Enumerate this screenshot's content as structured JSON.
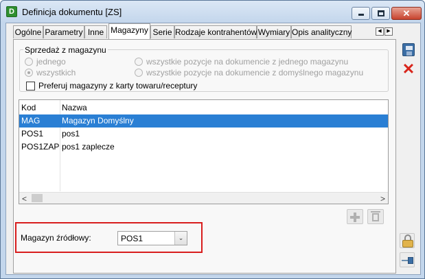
{
  "window": {
    "title": "Definicja dokumentu [ZS]",
    "app_icon_letter": "D",
    "min_glyph": "",
    "close_glyph": "✕"
  },
  "tabs": [
    {
      "label": "Ogólne"
    },
    {
      "label": "Parametry"
    },
    {
      "label": "Inne"
    },
    {
      "label": "Magazyny",
      "active": true
    },
    {
      "label": "Serie"
    },
    {
      "label": "Rodzaje kontrahentów"
    },
    {
      "label": "Wymiary"
    },
    {
      "label": "Opis analityczny"
    }
  ],
  "tab_scroll": {
    "left": "◀",
    "right": "▶"
  },
  "sales_group": {
    "title": "Sprzedaż z magazynu",
    "options": [
      {
        "label": "jednego",
        "selected": false,
        "enabled": false
      },
      {
        "label": "wszystkich",
        "selected": true,
        "enabled": false
      },
      {
        "label": "wszystkie pozycje na dokumencie z jednego magazynu",
        "selected": false,
        "enabled": false
      },
      {
        "label": "wszystkie pozycje na dokumencie z domyślnego magazynu",
        "selected": false,
        "enabled": false
      }
    ],
    "checkbox_label": "Preferuj magazyny z karty towaru/receptury",
    "checkbox_checked": false
  },
  "warehouse_grid": {
    "columns": [
      "Kod",
      "Nazwa"
    ],
    "rows": [
      {
        "kod": "MAG",
        "nazwa": "Magazyn Domyślny",
        "selected": true
      },
      {
        "kod": "POS1",
        "nazwa": "pos1",
        "selected": false
      },
      {
        "kod": "POS1ZAP",
        "nazwa": "pos1 zaplecze",
        "selected": false
      }
    ],
    "scroll_left": "<",
    "scroll_right": ">"
  },
  "source_warehouse": {
    "label": "Magazyn źródłowy:",
    "value": "POS1",
    "dropdown_glyph": "⌄"
  },
  "colors": {
    "selection": "#2a7fd4",
    "highlight_border": "#d81c1c",
    "delete_icon": "#d8241a",
    "save_icon": "#3b6ea5"
  },
  "icons": [
    "app-icon",
    "minimize-icon",
    "maximize-icon",
    "close-icon",
    "save-icon",
    "cancel-icon",
    "add-icon",
    "delete-icon",
    "lock-icon",
    "pin-icon",
    "chevron-down-icon"
  ]
}
